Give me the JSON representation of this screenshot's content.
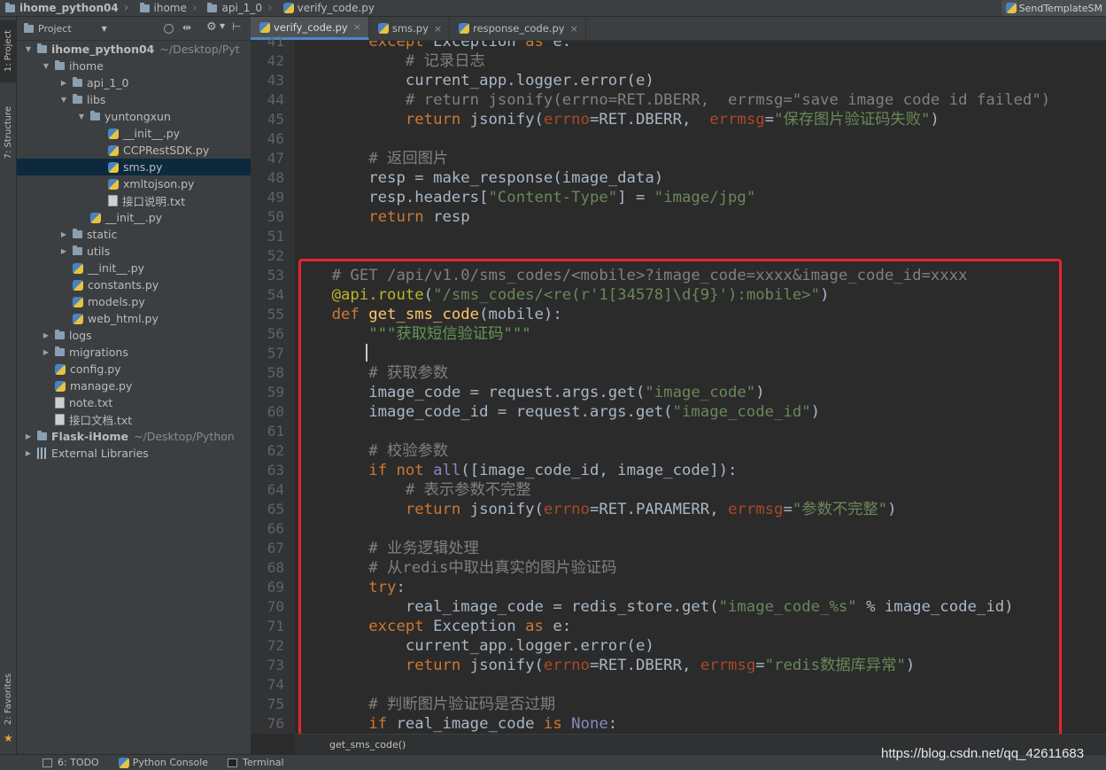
{
  "navbar": {
    "crumbs": [
      "ihome_python04",
      "ihome",
      "api_1_0",
      "verify_code.py"
    ],
    "right_tab": "SendTemplateSM"
  },
  "left_strip": {
    "project_tab": "1: Project",
    "structure_tab": "7: Structure",
    "favorites_tab": "2: Favorites"
  },
  "project_panel": {
    "view_label": "Project",
    "tree": [
      {
        "label": "ihome_python04",
        "hint": "~/Desktop/Pyt",
        "type": "folder",
        "depth": 0,
        "expanded": true,
        "bold": true
      },
      {
        "label": "ihome",
        "type": "folder",
        "depth": 1,
        "expanded": true
      },
      {
        "label": "api_1_0",
        "type": "folder",
        "depth": 2,
        "expanded": false
      },
      {
        "label": "libs",
        "type": "folder",
        "depth": 2,
        "expanded": true
      },
      {
        "label": "yuntongxun",
        "type": "folder",
        "depth": 3,
        "expanded": true
      },
      {
        "label": "__init__.py",
        "type": "py",
        "depth": 4
      },
      {
        "label": "CCPRestSDK.py",
        "type": "py",
        "depth": 4
      },
      {
        "label": "sms.py",
        "type": "py",
        "depth": 4,
        "selected": true
      },
      {
        "label": "xmltojson.py",
        "type": "py",
        "depth": 4
      },
      {
        "label": "接口说明.txt",
        "type": "txt",
        "depth": 4
      },
      {
        "label": "__init__.py",
        "type": "py",
        "depth": 3
      },
      {
        "label": "static",
        "type": "folder",
        "depth": 2,
        "expanded": false
      },
      {
        "label": "utils",
        "type": "folder",
        "depth": 2,
        "expanded": false
      },
      {
        "label": "__init__.py",
        "type": "py",
        "depth": 2
      },
      {
        "label": "constants.py",
        "type": "py",
        "depth": 2
      },
      {
        "label": "models.py",
        "type": "py",
        "depth": 2
      },
      {
        "label": "web_html.py",
        "type": "py",
        "depth": 2
      },
      {
        "label": "logs",
        "type": "folder",
        "depth": 1,
        "expanded": false
      },
      {
        "label": "migrations",
        "type": "folder",
        "depth": 1,
        "expanded": false
      },
      {
        "label": "config.py",
        "type": "py",
        "depth": 1
      },
      {
        "label": "manage.py",
        "type": "py",
        "depth": 1
      },
      {
        "label": "note.txt",
        "type": "txt",
        "depth": 1
      },
      {
        "label": "接口文档.txt",
        "type": "txt",
        "depth": 1
      },
      {
        "label": "Flask-iHome",
        "hint": "~/Desktop/Python",
        "type": "folder",
        "depth": 0,
        "expanded": false,
        "bold": true
      },
      {
        "label": "External Libraries",
        "type": "lib",
        "depth": 0,
        "expanded": false
      }
    ]
  },
  "editor_tabs": [
    {
      "label": "verify_code.py",
      "active": true
    },
    {
      "label": "sms.py",
      "active": false
    },
    {
      "label": "response_code.py",
      "active": false
    }
  ],
  "code": {
    "first_line_number": 41,
    "lines": [
      [
        [
          "kw",
          "        except "
        ],
        [
          "",
          "Exception "
        ],
        [
          "kw",
          "as "
        ],
        [
          "",
          "e:"
        ]
      ],
      [
        [
          "cm",
          "            # 记录日志"
        ]
      ],
      [
        [
          "",
          "            current_app.logger.error(e)"
        ]
      ],
      [
        [
          "cm",
          "            # return jsonify(errno=RET.DBERR,  errmsg=\"save image code id failed\")"
        ]
      ],
      [
        [
          "kw",
          "            return "
        ],
        [
          "",
          "jsonify("
        ],
        [
          "pa",
          "errno"
        ],
        [
          "",
          "=RET.DBERR,  "
        ],
        [
          "pa",
          "errmsg"
        ],
        [
          "",
          "="
        ],
        [
          "st",
          "\"保存图片验证码失败\""
        ],
        [
          "",
          ")"
        ]
      ],
      [
        [
          "",
          ""
        ]
      ],
      [
        [
          "cm",
          "        # 返回图片"
        ]
      ],
      [
        [
          "",
          "        resp = make_response(image_data)"
        ]
      ],
      [
        [
          "",
          "        resp.headers["
        ],
        [
          "st",
          "\"Content-Type\""
        ],
        [
          "",
          "] = "
        ],
        [
          "st",
          "\"image/jpg\""
        ]
      ],
      [
        [
          "kw",
          "        return "
        ],
        [
          "",
          "resp"
        ]
      ],
      [
        [
          "",
          ""
        ]
      ],
      [
        [
          "",
          ""
        ]
      ],
      [
        [
          "cm",
          "    # GET /api/v1.0/sms_codes/<mobile>?image_code=xxxx&image_code_id=xxxx"
        ]
      ],
      [
        [
          "dec",
          "    @api.route"
        ],
        [
          "",
          "("
        ],
        [
          "st",
          "\"/sms_codes/<re(r'1[34578]\\d{9}'):mobile>\""
        ],
        [
          "",
          ")"
        ]
      ],
      [
        [
          "kw",
          "    def "
        ],
        [
          "fn",
          "get_sms_code"
        ],
        [
          "",
          "(mobile):"
        ]
      ],
      [
        [
          "ds",
          "        \"\"\"获取短信验证码\"\"\""
        ]
      ],
      [
        [
          "",
          ""
        ]
      ],
      [
        [
          "cm",
          "        # 获取参数"
        ]
      ],
      [
        [
          "",
          "        image_code = request.args.get("
        ],
        [
          "st",
          "\"image_code\""
        ],
        [
          "",
          ")"
        ]
      ],
      [
        [
          "",
          "        image_code_id = request.args.get("
        ],
        [
          "st",
          "\"image_code_id\""
        ],
        [
          "",
          ")"
        ]
      ],
      [
        [
          "",
          ""
        ]
      ],
      [
        [
          "cm",
          "        # 校验参数"
        ]
      ],
      [
        [
          "kw",
          "        if not "
        ],
        [
          "bi",
          "all"
        ],
        [
          "",
          "([image_code_id, image_code]):"
        ]
      ],
      [
        [
          "cm",
          "            # 表示参数不完整"
        ]
      ],
      [
        [
          "kw",
          "            return "
        ],
        [
          "",
          "jsonify("
        ],
        [
          "pa",
          "errno"
        ],
        [
          "",
          "=RET.PARAMERR, "
        ],
        [
          "pa",
          "errmsg"
        ],
        [
          "",
          "="
        ],
        [
          "st",
          "\"参数不完整\""
        ],
        [
          "",
          ")"
        ]
      ],
      [
        [
          "",
          ""
        ]
      ],
      [
        [
          "cm",
          "        # 业务逻辑处理"
        ]
      ],
      [
        [
          "cm",
          "        # 从redis中取出真实的图片验证码"
        ]
      ],
      [
        [
          "kw",
          "        try"
        ],
        [
          "",
          ":"
        ]
      ],
      [
        [
          "",
          "            real_image_code = redis_store.get("
        ],
        [
          "st",
          "\"image_code_%s\""
        ],
        [
          "",
          " % image_code_id)"
        ]
      ],
      [
        [
          "kw",
          "        except "
        ],
        [
          "",
          "Exception "
        ],
        [
          "kw",
          "as "
        ],
        [
          "",
          "e:"
        ]
      ],
      [
        [
          "",
          "            current_app.logger.error(e)"
        ]
      ],
      [
        [
          "kw",
          "            return "
        ],
        [
          "",
          "jsonify("
        ],
        [
          "pa",
          "errno"
        ],
        [
          "",
          "=RET.DBERR, "
        ],
        [
          "pa",
          "errmsg"
        ],
        [
          "",
          "="
        ],
        [
          "st",
          "\"redis数据库异常\""
        ],
        [
          "",
          ")"
        ]
      ],
      [
        [
          "",
          ""
        ]
      ],
      [
        [
          "cm",
          "        # 判断图片验证码是否过期"
        ]
      ],
      [
        [
          "kw",
          "        if "
        ],
        [
          "",
          "real_image_code "
        ],
        [
          "kw",
          "is "
        ],
        [
          "bi",
          "None"
        ],
        [
          "",
          ":"
        ]
      ]
    ]
  },
  "code_breadcrumb": "get_sms_code()",
  "bottom_bar": {
    "todo": "6: TODO",
    "python_console": "Python Console",
    "terminal": "Terminal"
  },
  "watermark": "https://blog.csdn.net/qq_42611683",
  "colors": {
    "keyword": "#cc7832",
    "comment": "#808080",
    "string": "#6a8759",
    "decorator": "#bbb529",
    "function": "#ffc66d",
    "param": "#aa4926",
    "builtin": "#8888c6",
    "highlight_box": "#e8242f"
  }
}
